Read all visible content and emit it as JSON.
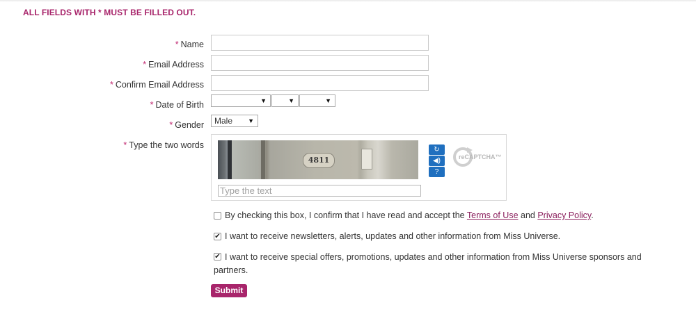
{
  "notice": "ALL FIELDS WITH * MUST BE FILLED OUT.",
  "required_marker": "*",
  "fields": {
    "name_label": "Name",
    "email_label": "Email Address",
    "confirm_email_label": "Confirm Email Address",
    "dob_label": "Date of Birth",
    "gender_label": "Gender",
    "captcha_label": "Type the two words"
  },
  "gender": {
    "selected": "Male"
  },
  "captcha": {
    "image_text": "4811",
    "input_placeholder": "Type the text",
    "logo_text": "reCAPTCHA™",
    "buttons": [
      "refresh-icon",
      "audio-icon",
      "help-icon"
    ]
  },
  "consents": {
    "terms": {
      "checked": false,
      "text_before": "By checking this box, I confirm that I have read and accept the ",
      "terms_link": "Terms of Use",
      "between": " and ",
      "privacy_link": "Privacy Policy",
      "text_after": "."
    },
    "newsletter": {
      "checked": true,
      "text": "I want to receive newsletters, alerts, updates and other information from Miss Universe."
    },
    "offers": {
      "checked": true,
      "text_line1": "I want to receive special offers, promotions, updates and other information from Miss Universe sponsors and",
      "text_line2": "partners."
    }
  },
  "submit_label": "Submit",
  "colors": {
    "accent": "#a8256b",
    "captcha_button": "#1f6fbf"
  }
}
